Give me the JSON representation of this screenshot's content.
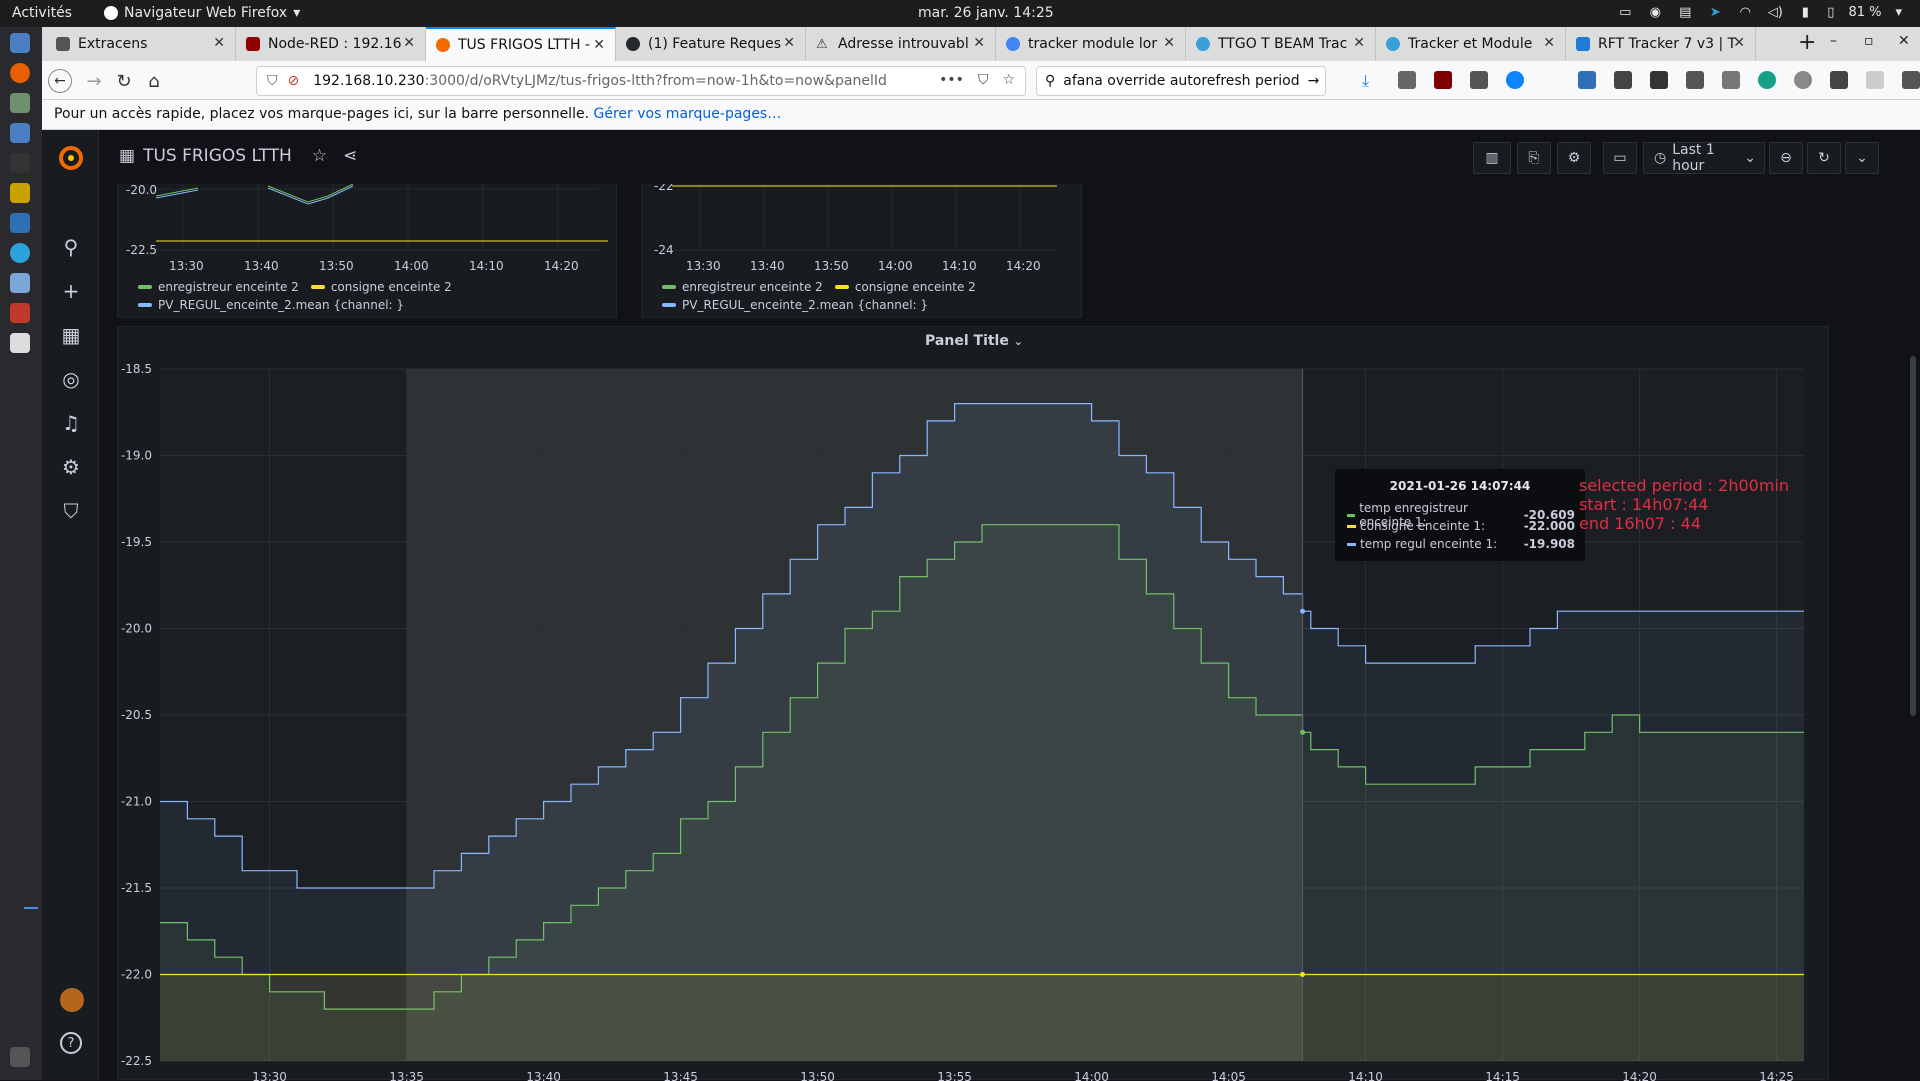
{
  "system": {
    "activities": "Activités",
    "app_name": "Navigateur Web Firefox",
    "clock": "mar. 26 janv.  14:25",
    "battery": "81 %"
  },
  "browser": {
    "tabs": [
      {
        "label": "Extracens",
        "color": "#555555"
      },
      {
        "label": "Node-RED : 192.16",
        "color": "#8f0000"
      },
      {
        "label": "TUS FRIGOS LTTH -",
        "color": "#f46800"
      },
      {
        "label": "(1) Feature Reques",
        "color": "#24292e"
      },
      {
        "label": "Adresse introuvabl",
        "color": "#e0a800"
      },
      {
        "label": "tracker module lor",
        "color": "#4285f4"
      },
      {
        "label": "TTGO T BEAM Trac",
        "color": "#3aa0d8"
      },
      {
        "label": "Tracker et Module",
        "color": "#3aa0d8"
      },
      {
        "label": "RFT Tracker 7 v3 | T",
        "color": "#1f7ad8"
      }
    ],
    "url_host": "192.168.10.230",
    "url_path": ":3000/d/oRVtyLJMz/tus-frigos-ltth?from=now-1h&to=now&panelId",
    "search_text": "afana override autorefresh period",
    "bookmarks_text": "Pour un accès rapide, placez vos marque-pages ici, sur la barre personnelle.",
    "bookmarks_link": "Gérer vos marque-pages…"
  },
  "dashboard": {
    "title": "TUS FRIGOS LTTH",
    "time_range": "Last 1 hour"
  },
  "top_left_panel": {
    "y_ticks": [
      "-20.0",
      "-22.5"
    ],
    "x_ticks": [
      "13:30",
      "13:40",
      "13:50",
      "14:00",
      "14:10",
      "14:20"
    ],
    "legend": [
      {
        "name": "enregistreur enceinte 2",
        "color": "#73bf69"
      },
      {
        "name": "consigne enceinte 2",
        "color": "#fade2a"
      },
      {
        "name": "PV_REGUL_enceinte_2.mean {channel: }",
        "color": "#8ab8ff"
      }
    ]
  },
  "top_right_panel": {
    "y_ticks": [
      "-22",
      "-24"
    ],
    "x_ticks": [
      "13:30",
      "13:40",
      "13:50",
      "14:00",
      "14:10",
      "14:20"
    ],
    "legend": [
      {
        "name": "enregistreur enceinte 2",
        "color": "#73bf69"
      },
      {
        "name": "consigne enceinte 2",
        "color": "#fade2a"
      },
      {
        "name": "PV_REGUL_enceinte_2.mean {channel: }",
        "color": "#8ab8ff"
      }
    ]
  },
  "main_panel": {
    "title": "Panel Title"
  },
  "tooltip": {
    "time": "2021-01-26 14:07:44",
    "rows": [
      {
        "label": "temp enregistreur enceinte 1:",
        "value": "-20.609",
        "color": "#73bf69"
      },
      {
        "label": "consigne enceinte 1:",
        "value": "-22.000",
        "color": "#fade2a"
      },
      {
        "label": "temp regul enceinte 1:",
        "value": "-19.908",
        "color": "#8ab8ff"
      }
    ]
  },
  "annotation": {
    "line1": "selected period : 2h00min",
    "line2": "start : 14h07:44",
    "line3": "end 16h07 : 44"
  },
  "chart_data": {
    "type": "line",
    "title": "Panel Title",
    "xlabel": "",
    "ylabel": "",
    "ylim": [
      -22.5,
      -18.5
    ],
    "xlim": [
      "13:26",
      "14:26"
    ],
    "x_ticks": [
      "13:30",
      "13:35",
      "13:40",
      "13:45",
      "13:50",
      "13:55",
      "14:00",
      "14:05",
      "14:10",
      "14:15",
      "14:20",
      "14:25"
    ],
    "y_ticks": [
      -18.5,
      -19.0,
      -19.5,
      -20.0,
      -20.5,
      -21.0,
      -21.5,
      -22.0,
      -22.5
    ],
    "series": [
      {
        "name": "temp regul enceinte 1",
        "color": "#8ab8ff",
        "points": [
          [
            "13:26",
            -21.0
          ],
          [
            "13:27",
            -21.1
          ],
          [
            "13:28",
            -21.2
          ],
          [
            "13:29",
            -21.4
          ],
          [
            "13:31",
            -21.5
          ],
          [
            "13:35",
            -21.5
          ],
          [
            "13:36",
            -21.4
          ],
          [
            "13:37",
            -21.3
          ],
          [
            "13:38",
            -21.2
          ],
          [
            "13:39",
            -21.1
          ],
          [
            "13:40",
            -21.0
          ],
          [
            "13:41",
            -20.9
          ],
          [
            "13:42",
            -20.8
          ],
          [
            "13:43",
            -20.7
          ],
          [
            "13:44",
            -20.6
          ],
          [
            "13:45",
            -20.4
          ],
          [
            "13:46",
            -20.2
          ],
          [
            "13:47",
            -20.0
          ],
          [
            "13:48",
            -19.8
          ],
          [
            "13:49",
            -19.6
          ],
          [
            "13:50",
            -19.4
          ],
          [
            "13:51",
            -19.3
          ],
          [
            "13:52",
            -19.1
          ],
          [
            "13:53",
            -19.0
          ],
          [
            "13:54",
            -18.8
          ],
          [
            "13:55",
            -18.7
          ],
          [
            "13:59",
            -18.7
          ],
          [
            "14:00",
            -18.8
          ],
          [
            "14:01",
            -19.0
          ],
          [
            "14:02",
            -19.1
          ],
          [
            "14:03",
            -19.3
          ],
          [
            "14:04",
            -19.5
          ],
          [
            "14:05",
            -19.6
          ],
          [
            "14:06",
            -19.7
          ],
          [
            "14:07",
            -19.8
          ],
          [
            "14:07.7",
            -19.9
          ],
          [
            "14:08",
            -20.0
          ],
          [
            "14:09",
            -20.1
          ],
          [
            "14:10",
            -20.2
          ],
          [
            "14:13",
            -20.2
          ],
          [
            "14:14",
            -20.1
          ],
          [
            "14:16",
            -20.0
          ],
          [
            "14:17",
            -19.9
          ],
          [
            "14:26",
            -19.9
          ]
        ]
      },
      {
        "name": "temp enregistreur enceinte 1",
        "color": "#73bf69",
        "points": [
          [
            "13:26",
            -21.7
          ],
          [
            "13:27",
            -21.8
          ],
          [
            "13:28",
            -21.9
          ],
          [
            "13:29",
            -22.0
          ],
          [
            "13:30",
            -22.1
          ],
          [
            "13:32",
            -22.2
          ],
          [
            "13:36",
            -22.1
          ],
          [
            "13:37",
            -22.0
          ],
          [
            "13:38",
            -21.9
          ],
          [
            "13:39",
            -21.8
          ],
          [
            "13:40",
            -21.7
          ],
          [
            "13:41",
            -21.6
          ],
          [
            "13:42",
            -21.5
          ],
          [
            "13:43",
            -21.4
          ],
          [
            "13:44",
            -21.3
          ],
          [
            "13:45",
            -21.1
          ],
          [
            "13:46",
            -21.0
          ],
          [
            "13:47",
            -20.8
          ],
          [
            "13:48",
            -20.6
          ],
          [
            "13:49",
            -20.4
          ],
          [
            "13:50",
            -20.2
          ],
          [
            "13:51",
            -20.0
          ],
          [
            "13:52",
            -19.9
          ],
          [
            "13:53",
            -19.7
          ],
          [
            "13:54",
            -19.6
          ],
          [
            "13:55",
            -19.5
          ],
          [
            "13:56",
            -19.4
          ],
          [
            "14:00",
            -19.4
          ],
          [
            "14:01",
            -19.6
          ],
          [
            "14:02",
            -19.8
          ],
          [
            "14:03",
            -20.0
          ],
          [
            "14:04",
            -20.2
          ],
          [
            "14:05",
            -20.4
          ],
          [
            "14:06",
            -20.5
          ],
          [
            "14:07.7",
            -20.6
          ],
          [
            "14:08",
            -20.7
          ],
          [
            "14:09",
            -20.8
          ],
          [
            "14:10",
            -20.9
          ],
          [
            "14:13",
            -20.9
          ],
          [
            "14:14",
            -20.8
          ],
          [
            "14:16",
            -20.7
          ],
          [
            "14:18",
            -20.6
          ],
          [
            "14:19",
            -20.5
          ],
          [
            "14:20",
            -20.6
          ],
          [
            "14:26",
            -20.6
          ]
        ]
      },
      {
        "name": "consigne enceinte 1",
        "color": "#fade2a",
        "points": [
          [
            "13:26",
            -22.0
          ],
          [
            "14:26",
            -22.0
          ]
        ]
      }
    ],
    "selection": {
      "from": "13:35",
      "to": "14:07.7"
    },
    "hover_time": "14:07.7"
  }
}
